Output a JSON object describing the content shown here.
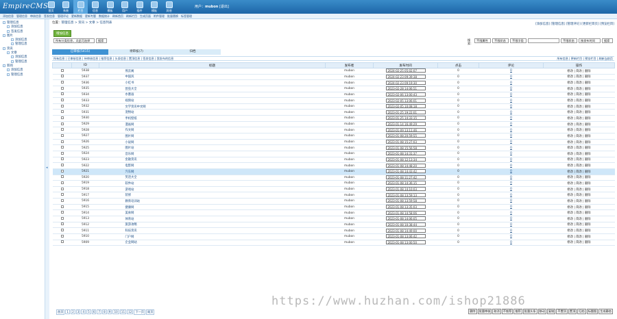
{
  "header": {
    "logo": "EmpireCMS",
    "logo_small": " ",
    "user_prefix": "用户：",
    "user_name": "mubon",
    "user_suffix": " [退出]",
    "nav": [
      {
        "label": "首页"
      },
      {
        "label": "系统"
      },
      {
        "label": "栏目"
      },
      {
        "label": "信息"
      },
      {
        "label": "模板"
      },
      {
        "label": "用户"
      },
      {
        "label": "插件"
      },
      {
        "label": "模板"
      },
      {
        "label": "其他"
      }
    ],
    "subnav": [
      "添加信息",
      "管理信息",
      "审核信息",
      "签发信息",
      "管理评论",
      "更新数据",
      "更新专题",
      "数据统计",
      "刷新首页",
      "刷新栏目",
      "生成页面",
      "附件管理",
      "批量替换",
      "标签管理"
    ]
  },
  "sidebar": [
    {
      "label": "管理信息",
      "level": 1
    },
    {
      "label": "添加信息",
      "level": 2
    },
    {
      "label": "签发信息",
      "level": 2
    },
    {
      "label": "图片",
      "level": 1
    },
    {
      "label": "添加信息",
      "level": 3
    },
    {
      "label": "管理信息",
      "level": 3
    },
    {
      "label": "资讯",
      "level": 1
    },
    {
      "label": "文章",
      "level": 2
    },
    {
      "label": "添加信息",
      "level": 3
    },
    {
      "label": "管理信息",
      "level": 3
    },
    {
      "label": "新闻",
      "level": 1
    },
    {
      "label": "添加信息",
      "level": 2
    },
    {
      "label": "管理信息",
      "level": 2
    }
  ],
  "breadcrumb": {
    "prefix": "位置：",
    "path": "管理信息 > 资讯 > 文章 > 信息列表"
  },
  "top_links": "[添加信息] [管理信息] [管理评论] [更新栏目页] [预览栏目]",
  "add_button": "增加信息",
  "filter": {
    "left_select": "所有分类信息，点此可选择",
    "left_btn": "搜索",
    "label": "搜索:",
    "sel1": "不限属性",
    "sel2": "不限状态",
    "sel3": "不限字段",
    "sel4": "不限状态",
    "sel5": "按发布时间",
    "btn": "搜索"
  },
  "tabs": [
    "已审核(5415)",
    "待审核(7)",
    "归档"
  ],
  "linkbar": {
    "left": "所有信息 | 已审核信息 | 待审核信息 | 推荐信息 | 头条信息 | 置顶信息 | 签发信息 | 我发布的信息",
    "right": "所有信息 | 更新栏目 | 预览栏目 | 刷新当前页"
  },
  "table": {
    "headers": [
      "",
      "ID",
      "标题",
      "发布者",
      "发布时间",
      "点击",
      "评论",
      "操作"
    ],
    "rows": [
      {
        "id": "5938",
        "title": "燕云阁",
        "author": "mubon",
        "time": "2024-02-25 05:02:07",
        "hits": "0",
        "comments": "0"
      },
      {
        "id": "5937",
        "title": "中国风",
        "author": "mubon",
        "time": "2024-02-23 09:39:38",
        "hits": "0",
        "comments": "0"
      },
      {
        "id": "5936",
        "title": "小红书",
        "author": "mubon",
        "time": "2024-02-23 09:19:30",
        "hits": "0",
        "comments": "0"
      },
      {
        "id": "5935",
        "title": "昆虫大全",
        "author": "mubon",
        "time": "2023-02-28 14:06:51",
        "hits": "0",
        "comments": "0"
      },
      {
        "id": "5934",
        "title": "水墨画",
        "author": "mubon",
        "time": "2023-02-06 13:00:43",
        "hits": "0",
        "comments": "0"
      },
      {
        "id": "5933",
        "title": "视频站",
        "author": "mubon",
        "time": "2023-02-05 13:06:01",
        "hits": "0",
        "comments": "0"
      },
      {
        "id": "5932",
        "title": "文学资讯中文网",
        "author": "mubon",
        "time": "2023-02-05 10:08:18",
        "hits": "0",
        "comments": "0"
      },
      {
        "id": "5931",
        "title": "宠物站",
        "author": "mubon",
        "time": "2023-01-25 19:22:01",
        "hits": "0",
        "comments": "0"
      },
      {
        "id": "5930",
        "title": "手机壁纸",
        "author": "mubon",
        "time": "2023-01-25 14:33:15",
        "hits": "0",
        "comments": "0"
      },
      {
        "id": "5929",
        "title": "漫画网",
        "author": "mubon",
        "time": "2023-01-14 16:49:29",
        "hits": "0",
        "comments": "0"
      },
      {
        "id": "5928",
        "title": "作文网",
        "author": "mubon",
        "time": "2023-01-09 13:11:46",
        "hits": "0",
        "comments": "0"
      },
      {
        "id": "5927",
        "title": "图片网",
        "author": "mubon",
        "time": "2023-01-08 20:59:55",
        "hits": "0",
        "comments": "0"
      },
      {
        "id": "5926",
        "title": "小说网",
        "author": "mubon",
        "time": "2023-01-08 15:27:03",
        "hits": "0",
        "comments": "0"
      },
      {
        "id": "5925",
        "title": "图片站",
        "author": "mubon",
        "time": "2023-01-08 15:56:58",
        "hits": "0",
        "comments": "0"
      },
      {
        "id": "5924",
        "title": "音乐网",
        "author": "mubon",
        "time": "2023-01-08 14:31:37",
        "hits": "0",
        "comments": "0"
      },
      {
        "id": "5923",
        "title": "金融资讯",
        "author": "mubon",
        "time": "2023-01-08 12:13:34",
        "hits": "0",
        "comments": "0"
      },
      {
        "id": "5922",
        "title": "电影网",
        "author": "mubon",
        "time": "2023-01-08 14:48:20",
        "hits": "0",
        "comments": "0"
      },
      {
        "id": "5921",
        "title": "汽车网",
        "author": "mubon",
        "time": "2023-01-08 14:43:42",
        "hits": "0",
        "comments": "0"
      },
      {
        "id": "5920",
        "title": "笑话大全",
        "author": "mubon",
        "time": "2023-01-08 11:27:42",
        "hits": "0",
        "comments": "0"
      },
      {
        "id": "5919",
        "title": "软件站",
        "author": "mubon",
        "time": "2023-01-08 14:36:15",
        "hits": "0",
        "comments": "0"
      },
      {
        "id": "5918",
        "title": "游戏站",
        "author": "mubon",
        "time": "2023-01-08 14:10:03",
        "hits": "0",
        "comments": "0"
      },
      {
        "id": "5917",
        "title": "装修",
        "author": "mubon",
        "time": "2023-01-08 13:59:13",
        "hits": "0",
        "comments": "0"
      },
      {
        "id": "5916",
        "title": "教育培训站",
        "author": "mubon",
        "time": "2023-01-08 13:59:58",
        "hits": "0",
        "comments": "0"
      },
      {
        "id": "5915",
        "title": "健康网",
        "author": "mubon",
        "time": "2023-01-08 13:35:03",
        "hits": "0",
        "comments": "0"
      },
      {
        "id": "5914",
        "title": "美食网",
        "author": "mubon",
        "time": "2023-01-08 14:58:06",
        "hits": "0",
        "comments": "0"
      },
      {
        "id": "5913",
        "title": "体育站",
        "author": "mubon",
        "time": "2023-01-08 14:06:05",
        "hits": "0",
        "comments": "0"
      },
      {
        "id": "5912",
        "title": "旅游攻略",
        "author": "mubon",
        "time": "2023-01-08 10:38:44",
        "hits": "0",
        "comments": "0"
      },
      {
        "id": "5911",
        "title": "科技资讯",
        "author": "mubon",
        "time": "2023-01-08 14:49:00",
        "hits": "0",
        "comments": "0"
      },
      {
        "id": "5910",
        "title": "门户网",
        "author": "mubon",
        "time": "2023-01-08 13:06:42",
        "hits": "0",
        "comments": "0"
      },
      {
        "id": "5909",
        "title": "企业网站",
        "author": "mubon",
        "time": "2023-01-08 13:00:50",
        "hits": "0",
        "comments": "0"
      }
    ],
    "ops": "修改 | 简改 | 删除"
  },
  "footer": {
    "pages": [
      "首页",
      "1",
      "2",
      "3",
      "4",
      "5",
      "6",
      "7",
      "8",
      "9",
      "10",
      "11",
      "12",
      "下一页",
      "尾页"
    ],
    "actions": [
      "删除",
      "批量审核",
      "取消",
      "不推荐",
      "推荐",
      "批量头条",
      "移动",
      "复制",
      "不置顶",
      "置顶",
      "归档",
      "标题图",
      "生成静态"
    ]
  },
  "watermark": "https://www.huzhan.com/ishop21886"
}
